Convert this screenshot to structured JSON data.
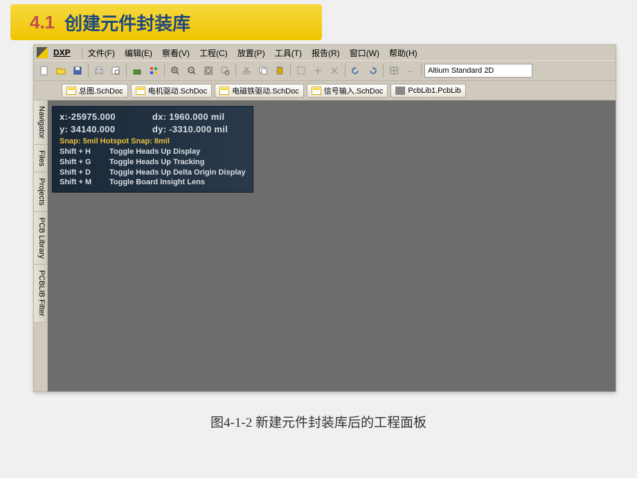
{
  "banner": {
    "num": "4.1",
    "text": "创建元件封装库"
  },
  "menu": {
    "dxp": "DXP",
    "items": [
      "文件(F)",
      "编辑(E)",
      "察看(V)",
      "工程(C)",
      "放置(P)",
      "工具(T)",
      "报告(R)",
      "窗口(W)",
      "帮助(H)"
    ]
  },
  "view_dropdown": "Altium Standard 2D",
  "tabs": {
    "items": [
      {
        "label": "总图.SchDoc",
        "type": "sch"
      },
      {
        "label": "电机驱动.SchDoc",
        "type": "sch"
      },
      {
        "label": "电磁铁驱动.SchDoc",
        "type": "sch"
      },
      {
        "label": "信号输入.SchDoc",
        "type": "sch"
      },
      {
        "label": "PcbLib1.PcbLib",
        "type": "pcb"
      }
    ]
  },
  "side_tabs": [
    "Navigator",
    "Files",
    "Projects",
    "PCB Library",
    "PCBLIB Filter"
  ],
  "hud": {
    "x": "x:-25975.000",
    "dx": "dx: 1960.000 mil",
    "y": "y: 34140.000",
    "dy": "dy: -3310.000 mil",
    "snap": "Snap: 5mil Hotspot Snap: 8mil",
    "hints": [
      {
        "key": "Shift + H",
        "action": "Toggle Heads Up Display"
      },
      {
        "key": "Shift + G",
        "action": "Toggle Heads Up Tracking"
      },
      {
        "key": "Shift + D",
        "action": "Toggle Heads Up Delta Origin Display"
      },
      {
        "key": "Shift + M",
        "action": "Toggle Board Insight Lens"
      }
    ]
  },
  "caption": "图4-1-2  新建元件封装库后的工程面板"
}
